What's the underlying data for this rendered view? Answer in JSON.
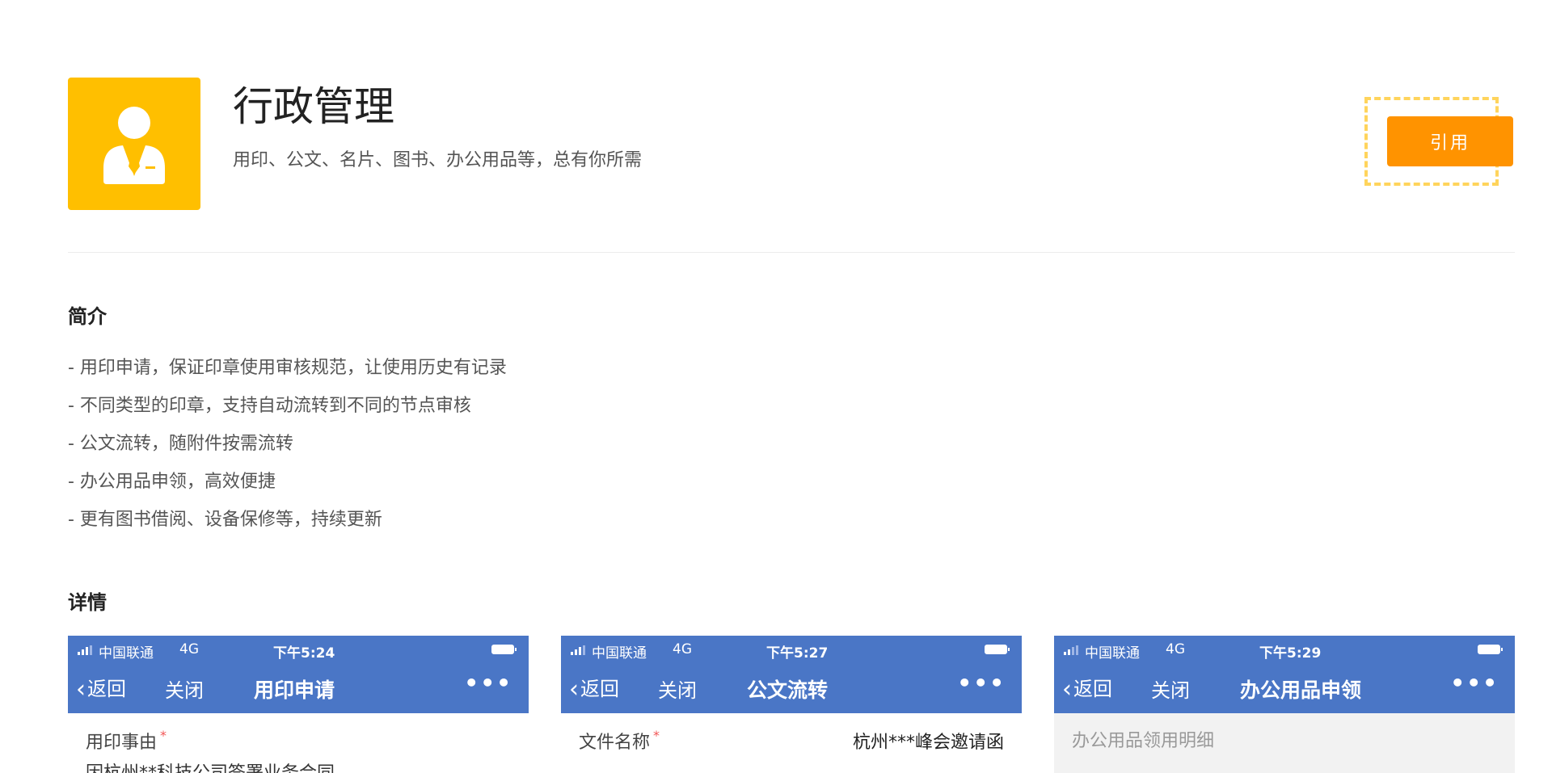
{
  "app": {
    "title": "行政管理",
    "subtitle": "用印、公文、名片、图书、办公用品等，总有你所需",
    "icon": "person-suit-icon",
    "icon_bg": "#ffbf00",
    "cite_label": "引用",
    "cite_color": "#ff9300"
  },
  "intro": {
    "title": "简介",
    "items": [
      "- 用印申请，保证印章使用审核规范，让使用历史有记录",
      "- 不同类型的印章，支持自动流转到不同的节点审核",
      "- 公文流转，随附件按需流转",
      "- 办公用品申领，高效便捷",
      "- 更有图书借阅、设备保修等，持续更新"
    ]
  },
  "details": {
    "title": "详情",
    "header_color": "#4a76c6",
    "cards": [
      {
        "carrier": "中国联通",
        "network": "4G",
        "time": "下午5:24",
        "back": "返回",
        "close": "关闭",
        "title": "用印申请",
        "more": "•••",
        "field_label": "用印事由",
        "field_required": "*",
        "field_value": "",
        "field_sub": "因杭州**科技公司签署业务合同"
      },
      {
        "carrier": "中国联通",
        "network": "4G",
        "time": "下午5:27",
        "back": "返回",
        "close": "关闭",
        "title": "公文流转",
        "more": "•••",
        "field_label": "文件名称",
        "field_required": "*",
        "field_value": "杭州***峰会邀请函",
        "field_sub": ""
      },
      {
        "carrier": "中国联通",
        "network": "4G",
        "time": "下午5:29",
        "back": "返回",
        "close": "关闭",
        "title": "办公用品申领",
        "more": "•••",
        "field_label": "办公用品领用明细",
        "field_required": "",
        "field_value": "",
        "field_sub": ""
      }
    ]
  }
}
